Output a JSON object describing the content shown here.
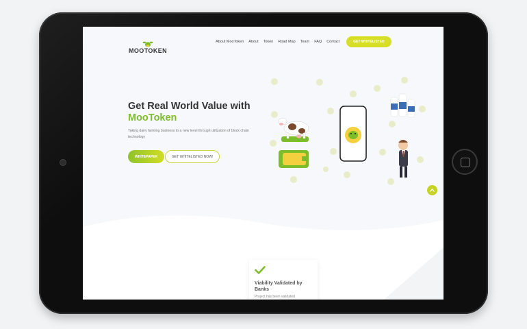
{
  "nav": {
    "logo": "MOOTOKEN",
    "links": [
      "About MooToken",
      "About",
      "Token",
      "Road Map",
      "Team",
      "FAQ",
      "Contact"
    ],
    "cta": "GET WHITELISTED"
  },
  "hero": {
    "title": "Get Real World Value with",
    "title_accent": "MooToken",
    "subtitle": "Taking dairy farming business to a new level through utilization of block chain technology",
    "btn_primary": "WHITEPAPER",
    "btn_outline": "GET WHITELISTED NOW!"
  },
  "card": {
    "title": "Viability Validated by Banks",
    "text": "Project has been validated"
  },
  "colors": {
    "accent": "#7dbd2c",
    "cta": "#d6df26",
    "text": "#333333"
  },
  "icons": {
    "logo": "cow-head-icon",
    "scroll": "chevron-up-icon",
    "card": "checkmark-icon"
  }
}
